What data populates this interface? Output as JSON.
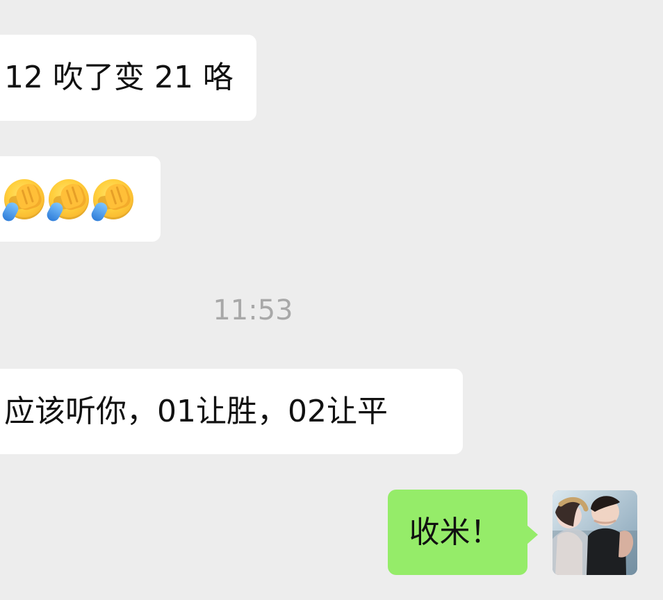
{
  "chat": {
    "messages": [
      {
        "sender": "other",
        "text": "12 吹了变 21 咯"
      },
      {
        "sender": "other",
        "emojis": [
          "facepalm-emoji",
          "facepalm-emoji",
          "facepalm-emoji"
        ]
      },
      {
        "sender": "other",
        "text": "应该听你，01让胜，02让平"
      },
      {
        "sender": "self",
        "text": "收米！"
      }
    ],
    "timestamp": "11:53"
  },
  "colors": {
    "background": "#ededed",
    "incoming_bubble": "#ffffff",
    "outgoing_bubble": "#95ec69",
    "timestamp_text": "#a8a8a8"
  }
}
